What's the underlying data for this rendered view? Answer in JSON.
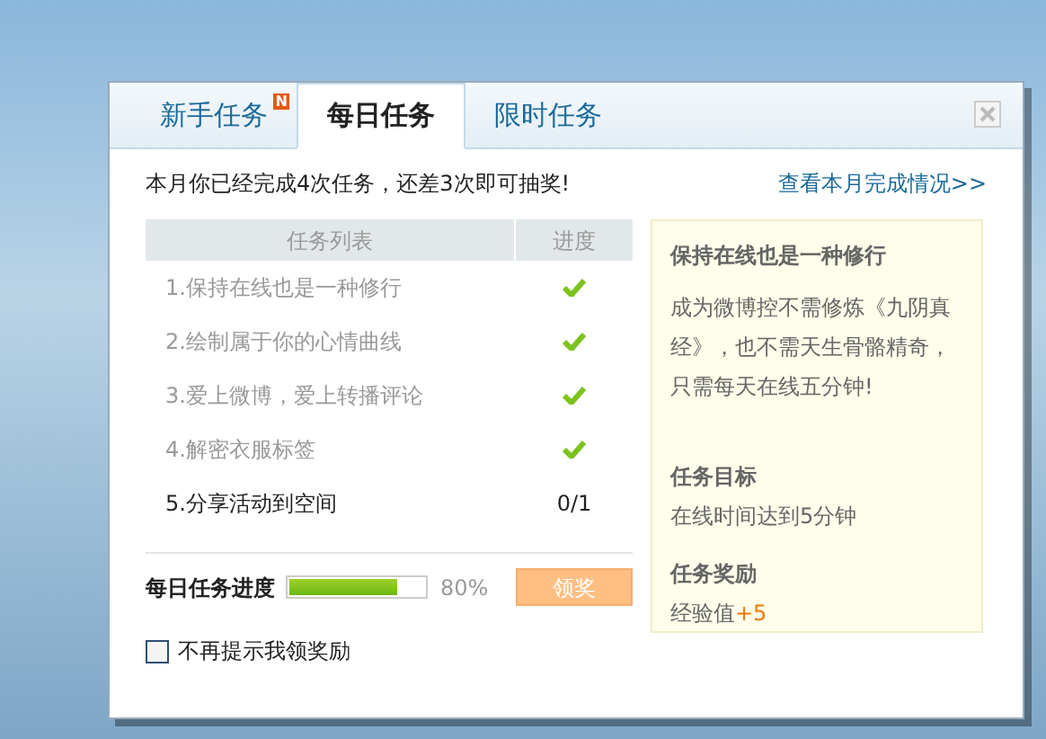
{
  "tabs": [
    {
      "label": "新手任务",
      "selected": false,
      "badge": "N"
    },
    {
      "label": "每日任务",
      "selected": true
    },
    {
      "label": "限时任务",
      "selected": false
    }
  ],
  "summary": "本月你已经完成4次任务，还差3次即可抽奖!",
  "link": "查看本月完成情况>>",
  "table": {
    "columns": [
      "任务列表",
      "进度"
    ],
    "rows": [
      {
        "task": "1.保持在线也是一种修行",
        "completed": true
      },
      {
        "task": "2.绘制属于你的心情曲线",
        "completed": true
      },
      {
        "task": "3.爱上微博，爱上转播评论",
        "completed": true
      },
      {
        "task": "4.解密衣服标签",
        "completed": true
      },
      {
        "task": "5.分享活动到空间",
        "completed": false,
        "progress": "0/1"
      }
    ]
  },
  "daily_progress": {
    "label": "每日任务进度",
    "level": 0.8,
    "reading": "80%",
    "button": "领奖"
  },
  "dont_remind": {
    "label": "不再提示我领奖励",
    "checked": false
  },
  "detail": {
    "title": "保持在线也是一种修行",
    "description": "成为微博控不需修炼《九阴真经》，也不需天生骨骼精奇，只需每天在线五分钟!",
    "sections": [
      {
        "heading": "任务目标",
        "text": "在线时间达到5分钟"
      },
      {
        "heading": "任务奖励",
        "text": "经验值",
        "highlight": "+5"
      }
    ]
  }
}
